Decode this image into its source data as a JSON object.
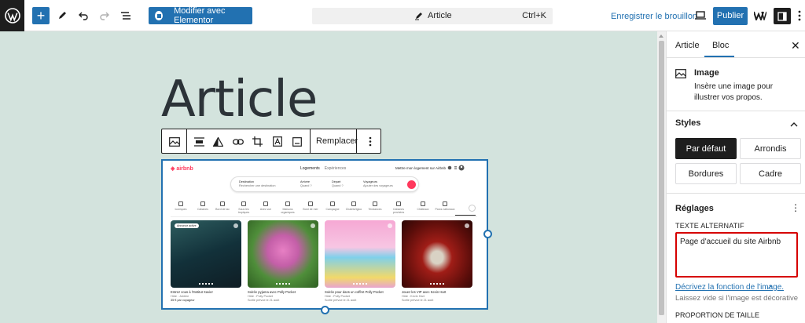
{
  "topbar": {
    "elementor_label": "Modifier avec Elementor",
    "doc_title": "Article",
    "shortcut": "Ctrl+K",
    "save_draft": "Enregistrer le brouillon",
    "publish": "Publier"
  },
  "editor": {
    "title": "Article",
    "replace_label": "Remplacer"
  },
  "airbnb": {
    "logo": "airbnb",
    "tab_lodging": "Logements",
    "tab_experiences": "Expériences",
    "host": "Mettre mon logement sur Airbnb",
    "search": {
      "dest_label": "Destination",
      "dest_value": "Rechercher une destination",
      "arrival_label": "Arrivée",
      "arrival_value": "Quand ?",
      "depart_label": "Départ",
      "depart_value": "Quand ?",
      "guests_label": "Voyageurs",
      "guests_value": "Ajouter des voyageurs"
    },
    "categories": [
      "Iconiques",
      "Cabanes",
      "Bord de lac",
      "Sous les tropiques",
      "Avec vue",
      "Maisons organiques",
      "Bord de mer",
      "Campagne",
      "Chalets/Igloo",
      "Tendances",
      "Cabanes perchées",
      "Châteaux",
      "Parcs nationaux"
    ],
    "cards": [
      {
        "title": "Entrez vous à l'Institut Xavier",
        "sub": "Hôte : Jubilee",
        "date": "",
        "price": "35 € par voyageur",
        "badge": "Annonce active",
        "c1": "#2e5d5f",
        "c2": "#0f1d24"
      },
      {
        "title": "Soirée pyjama avec Polly Pocket",
        "sub": "Hôte : Polly Pocket",
        "date": "Sortie prévue le 21 août",
        "price": "",
        "badge": "",
        "c1": "#7db04a",
        "c2": "#d46fb2"
      },
      {
        "title": "Soirée pour dans un coffret Polly Pocket",
        "sub": "Hôte : Polly Pocket",
        "date": "Sortie prévue le 21 août",
        "price": "",
        "badge": "",
        "c1": "#f3b2d8",
        "c2": "#6cc7e6"
      },
      {
        "title": "Jouez les VIP avec Kevin Hart",
        "sub": "Hôte : Kevin Hart",
        "date": "Sortie prévue le 21 août",
        "price": "",
        "badge": "",
        "c1": "#c0261f",
        "c2": "#3b0d0b"
      }
    ]
  },
  "sidebar": {
    "tab_article": "Article",
    "tab_bloc": "Bloc",
    "block_name": "Image",
    "block_desc": "Insère une image pour illustrer vos propos.",
    "styles_heading": "Styles",
    "style_options": [
      "Par défaut",
      "Arrondis",
      "Bordures",
      "Cadre"
    ],
    "reglages_heading": "Réglages",
    "alt_label": "TEXTE ALTERNATIF",
    "alt_value": "Page d'accueil du site Airbnb",
    "alt_link": "Décrivez la fonction de l'image.",
    "alt_help": "Laissez vide si l'image est décorative",
    "ratio_label": "PROPORTION DE TAILLE"
  }
}
